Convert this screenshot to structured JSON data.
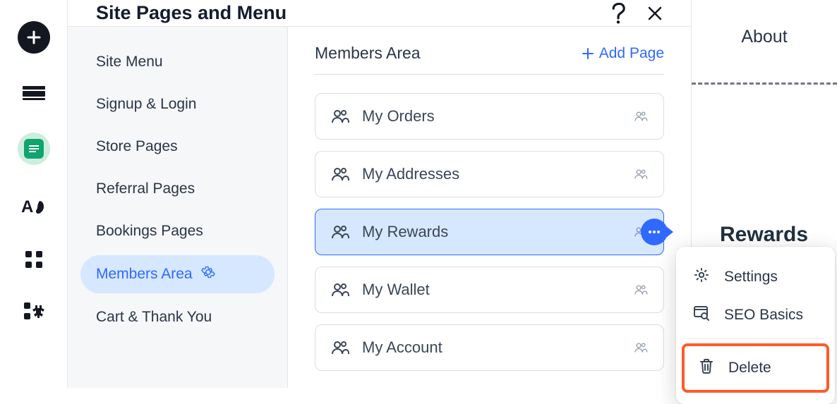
{
  "header": {
    "title": "Site Pages and Menu"
  },
  "categories": {
    "items": [
      "Site Menu",
      "Signup & Login",
      "Store Pages",
      "Referral Pages",
      "Bookings Pages",
      "Members Area",
      "Cart & Thank You"
    ]
  },
  "pages": {
    "title": "Members Area",
    "add_label": "Add Page",
    "items": [
      "My Orders",
      "My Addresses",
      "My Rewards",
      "My Wallet",
      "My Account"
    ]
  },
  "right": {
    "tab": "About",
    "heading": "Rewards"
  },
  "ctx": {
    "settings": "Settings",
    "seo": "SEO Basics",
    "delete": "Delete"
  }
}
